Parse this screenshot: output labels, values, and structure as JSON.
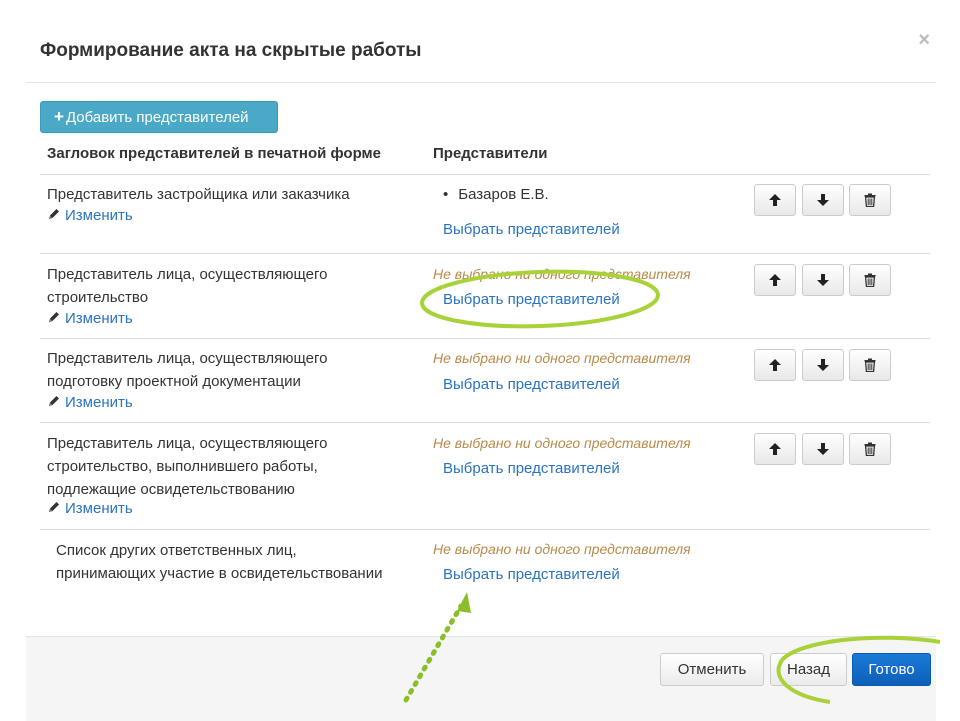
{
  "dialog": {
    "title": "Формирование акта на скрытые работы",
    "close_symbol": "×"
  },
  "toolbar": {
    "add_plus": "+",
    "add_label": "Добавить представителей"
  },
  "columns": {
    "header_title": "Загловок представителей в печатной форме",
    "representatives": "Представители"
  },
  "rows": [
    {
      "title_lines": [
        "Представитель застройщика или заказчика"
      ],
      "edit_label": "Изменить",
      "representatives": [
        "Базаров Е.В."
      ],
      "none_text": "",
      "choose_label": "Выбрать представителей",
      "has_actions": true
    },
    {
      "title_lines": [
        "Представитель лица, осуществляющего",
        "строительство"
      ],
      "edit_label": "Изменить",
      "representatives": [],
      "none_text": "Не выбрано ни одного представителя",
      "choose_label": "Выбрать представителей",
      "has_actions": true
    },
    {
      "title_lines": [
        "Представитель лица, осуществляющего",
        "подготовку проектной документации"
      ],
      "edit_label": "Изменить",
      "representatives": [],
      "none_text": "Не выбрано ни одного представителя",
      "choose_label": "Выбрать представителей",
      "has_actions": true
    },
    {
      "title_lines": [
        "Представитель лица, осуществляющего",
        "строительство, выполнившего работы,",
        "подлежащие освидетельствованию"
      ],
      "edit_label": "Изменить",
      "representatives": [],
      "none_text": "Не выбрано ни одного представителя",
      "choose_label": "Выбрать представителей",
      "has_actions": true
    },
    {
      "title_lines": [
        "Список других ответственных лиц,",
        "принимающих участие в освидетельствовании"
      ],
      "edit_label": "",
      "representatives": [],
      "none_text": "Не выбрано ни одного представителя",
      "choose_label": "Выбрать представителей",
      "has_actions": false
    }
  ],
  "footer": {
    "cancel_label": "Отменить",
    "back_label": "Назад",
    "done_label": "Готово"
  },
  "colors": {
    "link": "#2a73c2",
    "warning_text": "#b98a4a",
    "add_button": "#4ba9c8",
    "primary_button": "#0d5fb8",
    "annotation_highlight": "#a8d13a"
  },
  "icons": {
    "add": "plus-icon",
    "edit": "pencil-icon",
    "up": "arrow-up-icon",
    "down": "arrow-down-icon",
    "delete": "trash-icon",
    "close": "close-icon"
  }
}
